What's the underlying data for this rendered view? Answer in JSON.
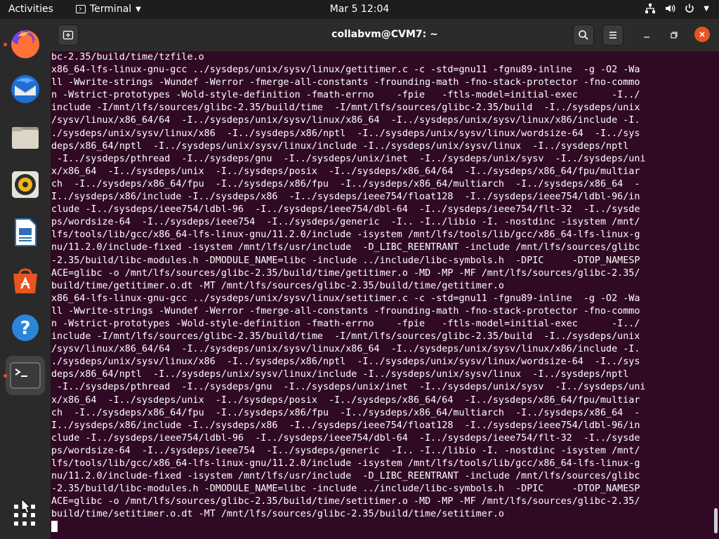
{
  "topbar": {
    "activities": "Activities",
    "app_name": "Terminal",
    "clock": "Mar 5  12:04"
  },
  "dock": {
    "apps": [
      "firefox",
      "thunderbird",
      "files",
      "rhythmbox",
      "libreoffice-writer",
      "app-center",
      "help",
      "terminal"
    ]
  },
  "window": {
    "title": "collabvm@CVM7: ~"
  },
  "terminal": {
    "lines": [
      "bc-2.35/build/time/tzfile.o",
      "x86_64-lfs-linux-gnu-gcc ../sysdeps/unix/sysv/linux/getitimer.c -c -std=gnu11 -fgnu89-inline  -g -O2 -Wa",
      "ll -Wwrite-strings -Wundef -Werror -fmerge-all-constants -frounding-math -fno-stack-protector -fno-commo",
      "n -Wstrict-prototypes -Wold-style-definition -fmath-errno    -fpie   -ftls-model=initial-exec      -I../",
      "include -I/mnt/lfs/sources/glibc-2.35/build/time  -I/mnt/lfs/sources/glibc-2.35/build  -I../sysdeps/unix",
      "/sysv/linux/x86_64/64  -I../sysdeps/unix/sysv/linux/x86_64  -I../sysdeps/unix/sysv/linux/x86/include -I.",
      "./sysdeps/unix/sysv/linux/x86  -I../sysdeps/x86/nptl  -I../sysdeps/unix/sysv/linux/wordsize-64  -I../sys",
      "deps/x86_64/nptl  -I../sysdeps/unix/sysv/linux/include -I../sysdeps/unix/sysv/linux  -I../sysdeps/nptl",
      " -I../sysdeps/pthread  -I../sysdeps/gnu  -I../sysdeps/unix/inet  -I../sysdeps/unix/sysv  -I../sysdeps/uni",
      "x/x86_64  -I../sysdeps/unix  -I../sysdeps/posix  -I../sysdeps/x86_64/64  -I../sysdeps/x86_64/fpu/multiar",
      "ch  -I../sysdeps/x86_64/fpu  -I../sysdeps/x86/fpu  -I../sysdeps/x86_64/multiarch  -I../sysdeps/x86_64  -",
      "I../sysdeps/x86/include -I../sysdeps/x86  -I../sysdeps/ieee754/float128  -I../sysdeps/ieee754/ldbl-96/in",
      "clude -I../sysdeps/ieee754/ldbl-96  -I../sysdeps/ieee754/dbl-64  -I../sysdeps/ieee754/flt-32  -I../sysde",
      "ps/wordsize-64  -I../sysdeps/ieee754  -I../sysdeps/generic  -I.. -I../libio -I. -nostdinc -isystem /mnt/",
      "lfs/tools/lib/gcc/x86_64-lfs-linux-gnu/11.2.0/include -isystem /mnt/lfs/tools/lib/gcc/x86_64-lfs-linux-g",
      "nu/11.2.0/include-fixed -isystem /mnt/lfs/usr/include  -D_LIBC_REENTRANT -include /mnt/lfs/sources/glibc",
      "-2.35/build/libc-modules.h -DMODULE_NAME=libc -include ../include/libc-symbols.h  -DPIC     -DTOP_NAMESP",
      "ACE=glibc -o /mnt/lfs/sources/glibc-2.35/build/time/getitimer.o -MD -MP -MF /mnt/lfs/sources/glibc-2.35/",
      "build/time/getitimer.o.dt -MT /mnt/lfs/sources/glibc-2.35/build/time/getitimer.o",
      "x86_64-lfs-linux-gnu-gcc ../sysdeps/unix/sysv/linux/setitimer.c -c -std=gnu11 -fgnu89-inline  -g -O2 -Wa",
      "ll -Wwrite-strings -Wundef -Werror -fmerge-all-constants -frounding-math -fno-stack-protector -fno-commo",
      "n -Wstrict-prototypes -Wold-style-definition -fmath-errno    -fpie   -ftls-model=initial-exec      -I../",
      "include -I/mnt/lfs/sources/glibc-2.35/build/time  -I/mnt/lfs/sources/glibc-2.35/build  -I../sysdeps/unix",
      "/sysv/linux/x86_64/64  -I../sysdeps/unix/sysv/linux/x86_64  -I../sysdeps/unix/sysv/linux/x86/include -I.",
      "./sysdeps/unix/sysv/linux/x86  -I../sysdeps/x86/nptl  -I../sysdeps/unix/sysv/linux/wordsize-64  -I../sys",
      "deps/x86_64/nptl  -I../sysdeps/unix/sysv/linux/include -I../sysdeps/unix/sysv/linux  -I../sysdeps/nptl",
      " -I../sysdeps/pthread  -I../sysdeps/gnu  -I../sysdeps/unix/inet  -I../sysdeps/unix/sysv  -I../sysdeps/uni",
      "x/x86_64  -I../sysdeps/unix  -I../sysdeps/posix  -I../sysdeps/x86_64/64  -I../sysdeps/x86_64/fpu/multiar",
      "ch  -I../sysdeps/x86_64/fpu  -I../sysdeps/x86/fpu  -I../sysdeps/x86_64/multiarch  -I../sysdeps/x86_64  -",
      "I../sysdeps/x86/include -I../sysdeps/x86  -I../sysdeps/ieee754/float128  -I../sysdeps/ieee754/ldbl-96/in",
      "clude -I../sysdeps/ieee754/ldbl-96  -I../sysdeps/ieee754/dbl-64  -I../sysdeps/ieee754/flt-32  -I../sysde",
      "ps/wordsize-64  -I../sysdeps/ieee754  -I../sysdeps/generic  -I.. -I../libio -I. -nostdinc -isystem /mnt/",
      "lfs/tools/lib/gcc/x86_64-lfs-linux-gnu/11.2.0/include -isystem /mnt/lfs/tools/lib/gcc/x86_64-lfs-linux-g",
      "nu/11.2.0/include-fixed -isystem /mnt/lfs/usr/include  -D_LIBC_REENTRANT -include /mnt/lfs/sources/glibc",
      "-2.35/build/libc-modules.h -DMODULE_NAME=libc -include ../include/libc-symbols.h  -DPIC     -DTOP_NAMESP",
      "ACE=glibc -o /mnt/lfs/sources/glibc-2.35/build/time/setitimer.o -MD -MP -MF /mnt/lfs/sources/glibc-2.35/",
      "build/time/setitimer.o.dt -MT /mnt/lfs/sources/glibc-2.35/build/time/setitimer.o"
    ]
  },
  "colors": {
    "terminal_bg": "#300a24",
    "accent": "#e95420",
    "topbar_bg": "#1d1d1d",
    "dock_bg": "#2a2a2a"
  }
}
